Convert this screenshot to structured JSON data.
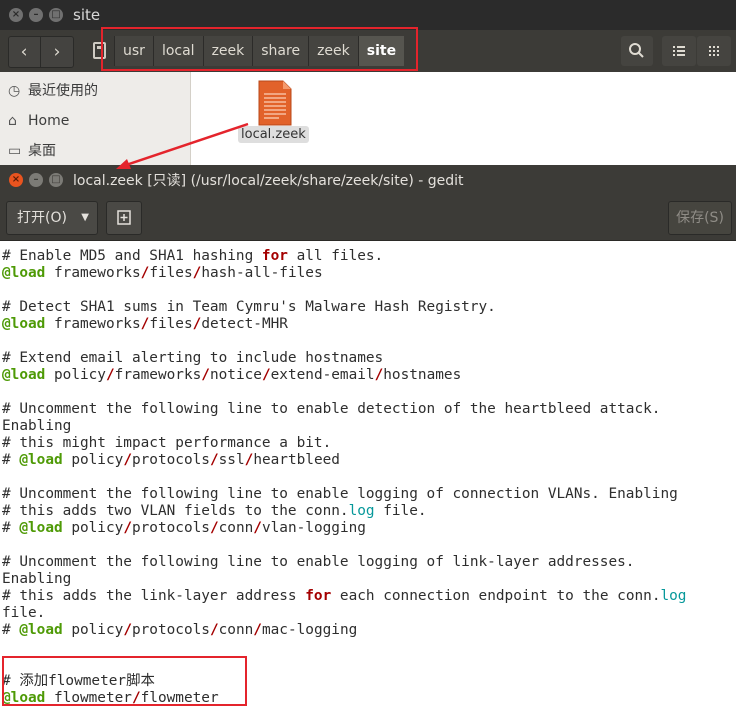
{
  "file_manager": {
    "title": "site",
    "path": [
      "usr",
      "local",
      "zeek",
      "share",
      "zeek",
      "site"
    ],
    "sidebar": [
      "最近使用的",
      "Home",
      "桌面"
    ],
    "file_name": "local.zeek"
  },
  "gedit": {
    "title": "local.zeek [只读] (/usr/local/zeek/share/zeek/site) - gedit",
    "open_label": "打开(O)",
    "save_label": "保存(S)",
    "lines": [
      [
        {
          "t": "# Enable MD5 and SHA1 hashing "
        },
        {
          "t": "for",
          "c": "kw"
        },
        {
          "t": " all files."
        }
      ],
      [
        {
          "t": "@load",
          "c": "ld"
        },
        {
          "t": " frameworks"
        },
        {
          "t": "/",
          "c": "sl"
        },
        {
          "t": "files"
        },
        {
          "t": "/",
          "c": "sl"
        },
        {
          "t": "hash-all-files"
        }
      ],
      [],
      [
        {
          "t": "# Detect SHA1 sums in Team Cymru's Malware Hash Registry."
        }
      ],
      [
        {
          "t": "@load",
          "c": "ld"
        },
        {
          "t": " frameworks"
        },
        {
          "t": "/",
          "c": "sl"
        },
        {
          "t": "files"
        },
        {
          "t": "/",
          "c": "sl"
        },
        {
          "t": "detect-MHR"
        }
      ],
      [],
      [
        {
          "t": "# Extend email alerting to include hostnames"
        }
      ],
      [
        {
          "t": "@load",
          "c": "ld"
        },
        {
          "t": " policy"
        },
        {
          "t": "/",
          "c": "sl"
        },
        {
          "t": "frameworks"
        },
        {
          "t": "/",
          "c": "sl"
        },
        {
          "t": "notice"
        },
        {
          "t": "/",
          "c": "sl"
        },
        {
          "t": "extend-email"
        },
        {
          "t": "/",
          "c": "sl"
        },
        {
          "t": "hostnames"
        }
      ],
      [],
      [
        {
          "t": "# Uncomment the following line to enable detection of the heartbleed attack."
        }
      ],
      [
        {
          "t": "Enabling"
        }
      ],
      [
        {
          "t": "# this might impact performance a bit."
        }
      ],
      [
        {
          "t": "# "
        },
        {
          "t": "@load",
          "c": "ld"
        },
        {
          "t": " policy"
        },
        {
          "t": "/",
          "c": "sl"
        },
        {
          "t": "protocols"
        },
        {
          "t": "/",
          "c": "sl"
        },
        {
          "t": "ssl"
        },
        {
          "t": "/",
          "c": "sl"
        },
        {
          "t": "heartbleed"
        }
      ],
      [],
      [
        {
          "t": "# Uncomment the following line to enable logging of connection VLANs. Enabling"
        }
      ],
      [
        {
          "t": "# this adds two VLAN fields to the conn."
        },
        {
          "t": "log",
          "c": "lg"
        },
        {
          "t": " file."
        }
      ],
      [
        {
          "t": "# "
        },
        {
          "t": "@load",
          "c": "ld"
        },
        {
          "t": " policy"
        },
        {
          "t": "/",
          "c": "sl"
        },
        {
          "t": "protocols"
        },
        {
          "t": "/",
          "c": "sl"
        },
        {
          "t": "conn"
        },
        {
          "t": "/",
          "c": "sl"
        },
        {
          "t": "vlan-logging"
        }
      ],
      [],
      [
        {
          "t": "# Uncomment the following line to enable logging of link-layer addresses."
        }
      ],
      [
        {
          "t": "Enabling"
        }
      ],
      [
        {
          "t": "# this adds the link-layer address "
        },
        {
          "t": "for",
          "c": "kw"
        },
        {
          "t": " each connection endpoint to the conn."
        },
        {
          "t": "log",
          "c": "lg"
        }
      ],
      [
        {
          "t": "file."
        }
      ],
      [
        {
          "t": "# "
        },
        {
          "t": "@load",
          "c": "ld"
        },
        {
          "t": " policy"
        },
        {
          "t": "/",
          "c": "sl"
        },
        {
          "t": "protocols"
        },
        {
          "t": "/",
          "c": "sl"
        },
        {
          "t": "conn"
        },
        {
          "t": "/",
          "c": "sl"
        },
        {
          "t": "mac-logging"
        }
      ],
      [],
      [],
      [
        {
          "t": "# 添加flowmeter脚本"
        }
      ],
      [
        {
          "t": "@load",
          "c": "ld"
        },
        {
          "t": " flowmeter"
        },
        {
          "t": "/",
          "c": "sl"
        },
        {
          "t": "flowmeter"
        }
      ]
    ]
  }
}
